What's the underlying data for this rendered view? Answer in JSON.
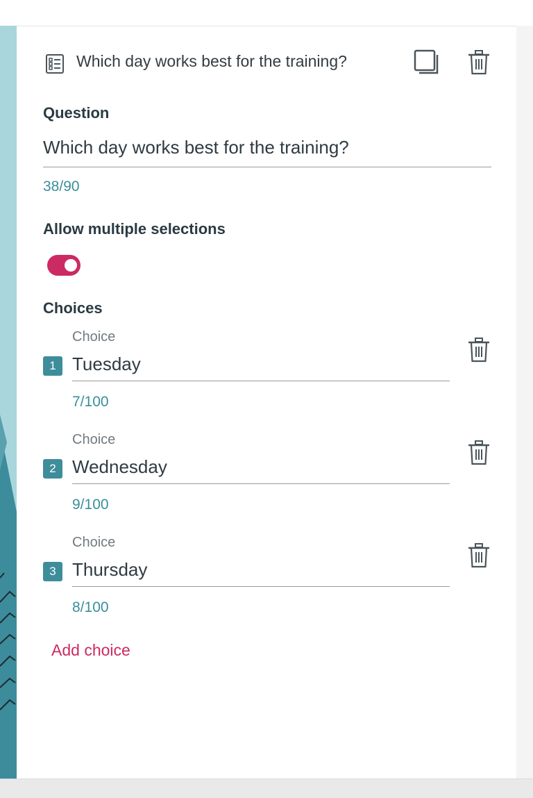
{
  "question": {
    "header_title": "Which day works best for the training?",
    "label": "Question",
    "value": "Which day works best for the training?",
    "counter": "38/90"
  },
  "multiple": {
    "label": "Allow multiple selections",
    "enabled": true
  },
  "choices": {
    "label": "Choices",
    "add_label": "Add choice",
    "items": [
      {
        "number": "1",
        "caption": "Choice",
        "value": "Tuesday",
        "counter": "7/100"
      },
      {
        "number": "2",
        "caption": "Choice",
        "value": "Wednesday",
        "counter": "9/100"
      },
      {
        "number": "3",
        "caption": "Choice",
        "value": "Thursday",
        "counter": "8/100"
      }
    ]
  },
  "colors": {
    "accent": "#cc2a62",
    "teal": "#3e8d9b",
    "counter": "#3a8f9a"
  },
  "icons": [
    "list-icon",
    "copy-icon",
    "trash-icon"
  ]
}
